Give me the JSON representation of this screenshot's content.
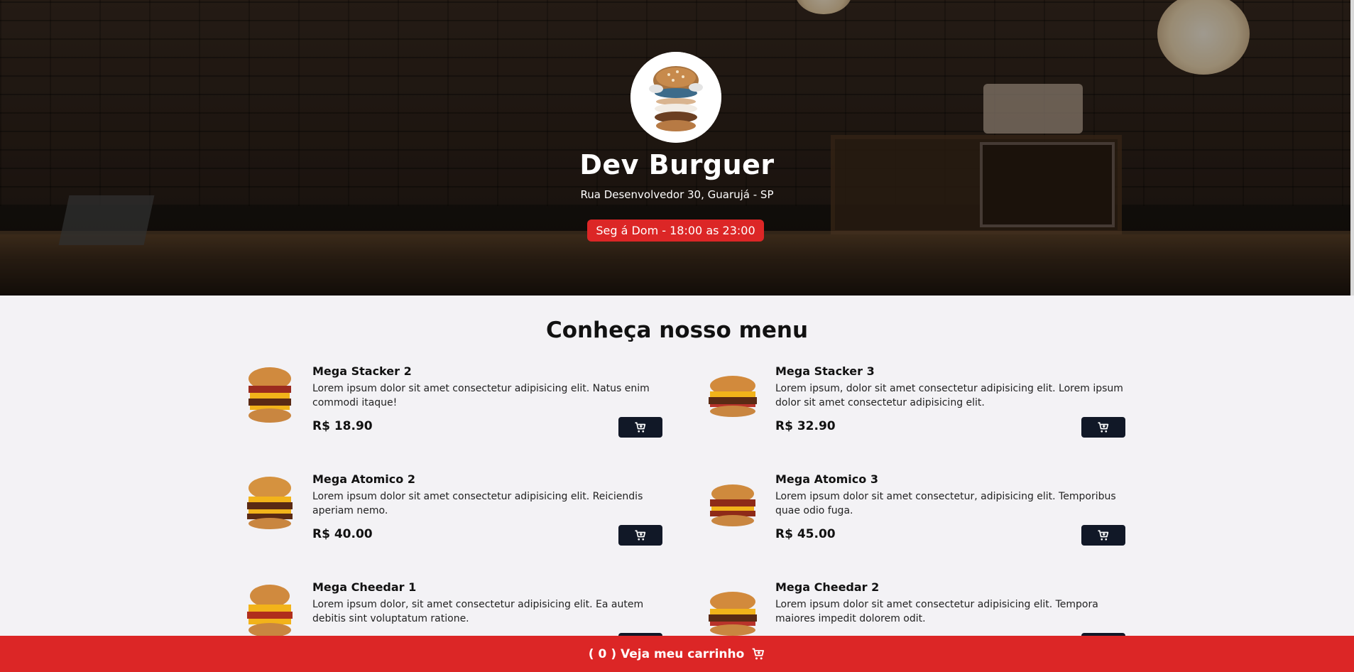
{
  "header": {
    "brand_name": "Dev Burguer",
    "address": "Rua Desenvolvedor 30, Guarujá - SP",
    "hours": "Seg á Dom - 18:00 as 23:00",
    "logo_icon": "burger-logo-icon"
  },
  "menu": {
    "title": "Conheça nosso menu",
    "items": [
      {
        "name": "Mega Stacker 2",
        "description": "Lorem ipsum dolor sit amet consectetur adipisicing elit. Natus enim commodi itaque!",
        "price": "R$ 18.90"
      },
      {
        "name": "Mega Stacker 3",
        "description": "Lorem ipsum, dolor sit amet consectetur adipisicing elit. Lorem ipsum dolor sit amet consectetur adipisicing elit.",
        "price": "R$ 32.90"
      },
      {
        "name": "Mega Atomico 2",
        "description": "Lorem ipsum dolor sit amet consectetur adipisicing elit. Reiciendis aperiam nemo.",
        "price": "R$ 40.00"
      },
      {
        "name": "Mega Atomico 3",
        "description": "Lorem ipsum dolor sit amet consectetur, adipisicing elit. Temporibus quae odio fuga.",
        "price": "R$ 45.00"
      },
      {
        "name": "Mega Cheedar 1",
        "description": "Lorem ipsum dolor, sit amet consectetur adipisicing elit. Ea autem debitis sint voluptatum ratione.",
        "price": ""
      },
      {
        "name": "Mega Cheedar 2",
        "description": "Lorem ipsum dolor sit amet consectetur adipisicing elit. Tempora maiores impedit dolorem odit.",
        "price": ""
      }
    ]
  },
  "footer": {
    "open_paren": "(",
    "cart_count": "0",
    "label": ") Veja meu carrinho",
    "icon": "cart-icon"
  },
  "colors": {
    "accent": "#dc2626",
    "button": "#111827",
    "background": "#f3f2f5"
  }
}
